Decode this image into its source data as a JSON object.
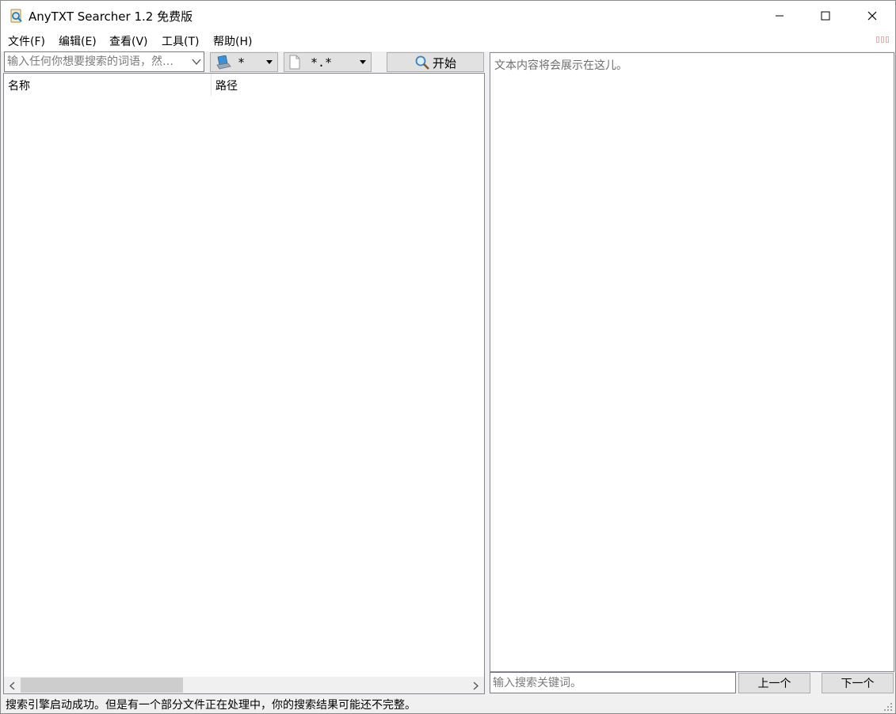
{
  "window": {
    "title": "AnyTXT Searcher 1.2 免费版"
  },
  "menu": {
    "items": [
      "文件(F)",
      "编辑(E)",
      "查看(V)",
      "工具(T)",
      "帮助(H)"
    ]
  },
  "toolbar": {
    "search_placeholder": "输入任何你想要搜索的词语，然…",
    "drive_value": "*",
    "filetype_value": "*.*",
    "start_label": "开始"
  },
  "results": {
    "columns": [
      "名称",
      "路径"
    ],
    "rows": []
  },
  "preview": {
    "placeholder_text": "文本内容将会展示在这儿。",
    "keyword_placeholder": "输入搜索关键词。",
    "prev_label": "上一个",
    "next_label": "下一个"
  },
  "status": {
    "text": "搜索引擎启动成功。但是有一个部分文件正在处理中，你的搜索结果可能还不完整。"
  },
  "colors": {
    "accent": "#1e88e5",
    "window_bg": "#f0f0f0",
    "button_bg": "#e1e1e1"
  },
  "icons": {
    "app": "magnifier-document-icon",
    "drive": "computer-drive-icon",
    "filetype": "blank-file-icon",
    "start": "search-icon"
  }
}
